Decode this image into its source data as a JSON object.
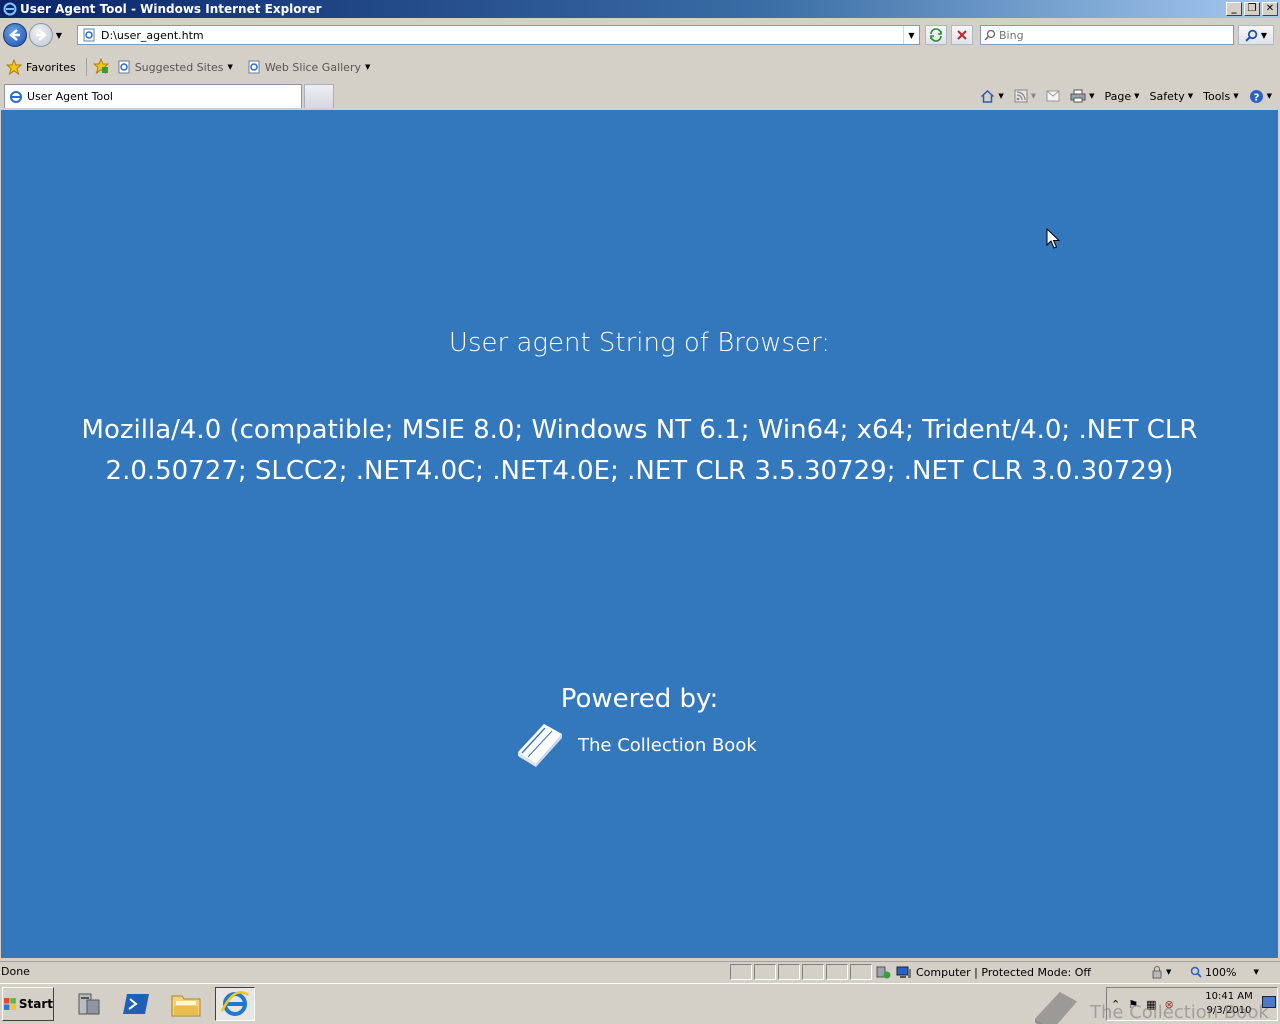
{
  "window": {
    "title": "User Agent Tool - Windows Internet Explorer",
    "min": "_",
    "max": "❐",
    "close": "✕"
  },
  "address": {
    "url": "D:\\user_agent.htm",
    "search_placeholder": "Bing"
  },
  "favorites": {
    "favorites_label": "Favorites",
    "links": [
      {
        "label": "Suggested Sites"
      },
      {
        "label": "Web Slice Gallery"
      }
    ]
  },
  "tabs": [
    {
      "label": "User Agent Tool"
    }
  ],
  "commands": {
    "page": "Page",
    "safety": "Safety",
    "tools": "Tools"
  },
  "content": {
    "heading": "User agent String of Browser:",
    "ua_string": "Mozilla/4.0 (compatible; MSIE 8.0; Windows NT 6.1; Win64; x64; Trident/4.0; .NET CLR 2.0.50727; SLCC2; .NET4.0C; .NET4.0E; .NET CLR 3.5.30729; .NET CLR 3.0.30729)",
    "powered_by": "Powered by:",
    "brand": "The Collection Book",
    "background_color": "#3377bd"
  },
  "statusbar": {
    "status": "Done",
    "zone": "Computer | Protected Mode: Off",
    "zoom": "100%"
  },
  "taskbar": {
    "start": "Start",
    "time": "10:41 AM",
    "date": "9/3/2010",
    "watermark": "The Collection Book"
  }
}
